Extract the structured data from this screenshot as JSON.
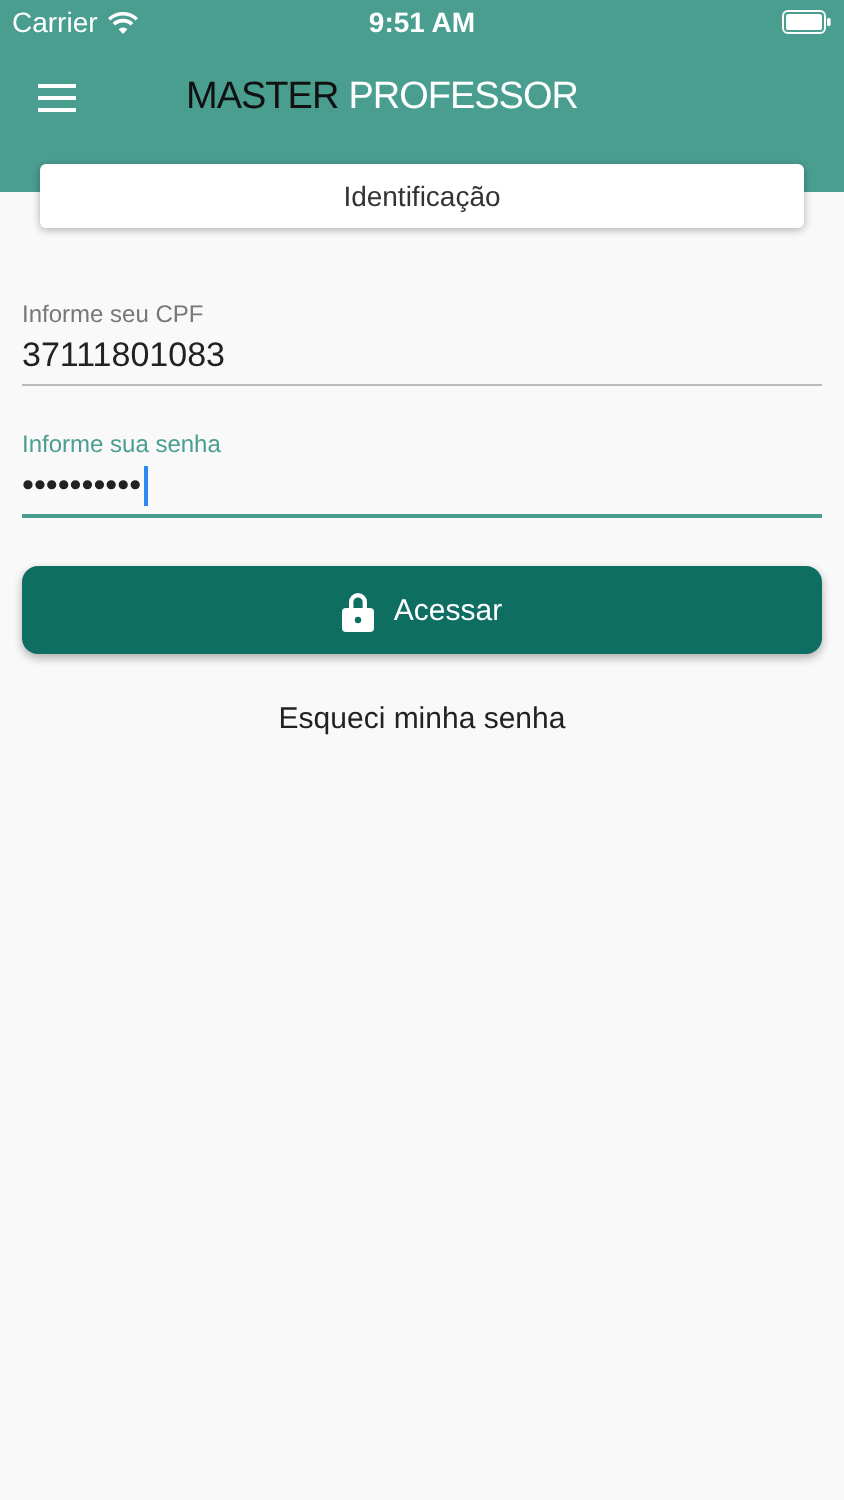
{
  "status_bar": {
    "carrier": "Carrier",
    "time": "9:51 AM"
  },
  "header": {
    "title_dark": "MASTER",
    "title_light": "PROFESSOR"
  },
  "tab_card": {
    "label": "Identificação"
  },
  "fields": [
    {
      "label": "Informe seu CPF",
      "value": "37111801083",
      "focused": false
    },
    {
      "label": "Informe sua senha",
      "value": "••••••••••",
      "focused": true
    }
  ],
  "login_button": {
    "label": "Acessar"
  },
  "forgot_link": "Esqueci minha senha"
}
